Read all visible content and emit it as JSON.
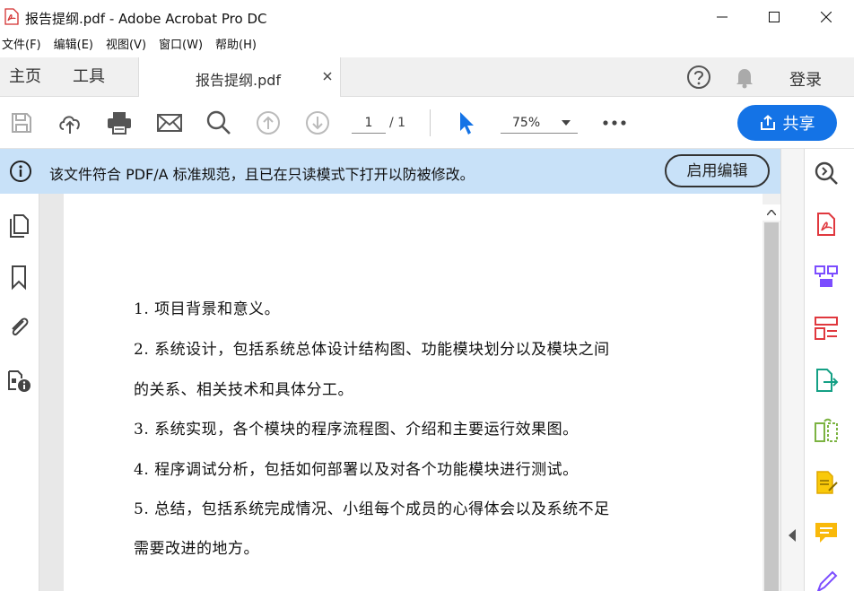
{
  "window": {
    "title": "报告提纲.pdf - Adobe Acrobat Pro DC",
    "controls": [
      "minimize",
      "maximize",
      "close"
    ]
  },
  "menu": [
    "文件(F)",
    "编辑(E)",
    "视图(V)",
    "窗口(W)",
    "帮助(H)"
  ],
  "tabs": {
    "home": "主页",
    "tools": "工具",
    "document": "报告提纲.pdf",
    "login": "登录"
  },
  "toolbar": {
    "page_current": "1",
    "page_total": "/ 1",
    "zoom": "75%",
    "share_label": "共享"
  },
  "infobar": {
    "message": "该文件符合 PDF/A 标准规范，且已在只读模式下打开以防被修改。",
    "enable_edit": "启用编辑"
  },
  "document": {
    "lines": [
      "1.  项目背景和意义。",
      "2.  系统设计，包括系统总体设计结构图、功能模块划分以及模块之间",
      "的关系、相关技术和具体分工。",
      "3.  系统实现，各个模块的程序流程图、介绍和主要运行效果图。",
      "4.  程序调试分析，包括如何部署以及对各个功能模块进行测试。",
      "5.  总结，包括系统完成情况、小组每个成员的心得体会以及系统不足",
      "需要改进的地方。"
    ]
  },
  "icons": {
    "left_rail": [
      "page-thumbnails-icon",
      "bookmark-icon",
      "attachment-icon",
      "file-info-icon"
    ],
    "right_pane": [
      "zoom-search-icon",
      "export-pdf-icon",
      "combine-files-icon",
      "organize-pages-icon",
      "export-icon",
      "compress-icon",
      "comment-icon",
      "fill-sign-icon"
    ]
  },
  "colors": {
    "accent": "#1473e6",
    "infobar_bg": "#c8e1f8",
    "select_tool": "#1473e6"
  }
}
